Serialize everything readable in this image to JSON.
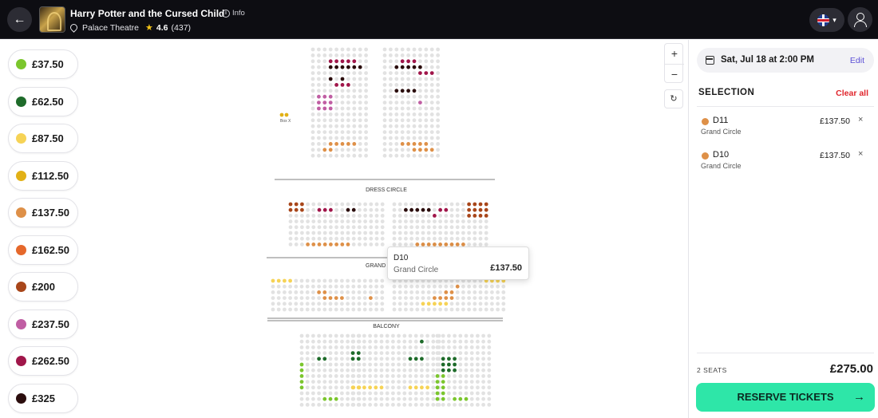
{
  "header": {
    "show_title": "Harry Potter and the Cursed Child",
    "info_label": "Info",
    "venue": "Palace Theatre",
    "rating": "4.6",
    "review_count": "(437)"
  },
  "legend": {
    "prices": [
      {
        "label": "£37.50",
        "color": "#7bc62d"
      },
      {
        "label": "£62.50",
        "color": "#1e6b2a"
      },
      {
        "label": "£87.50",
        "color": "#f6d356"
      },
      {
        "label": "£112.50",
        "color": "#e2b116"
      },
      {
        "label": "£137.50",
        "color": "#de9048"
      },
      {
        "label": "£162.50",
        "color": "#e5682b"
      },
      {
        "label": "£200",
        "color": "#a8461a"
      },
      {
        "label": "£237.50",
        "color": "#c05ea3"
      },
      {
        "label": "£262.50",
        "color": "#a0164a"
      },
      {
        "label": "£325",
        "color": "#2b0d0d"
      }
    ]
  },
  "map": {
    "section_labels": [
      "DRESS CIRCLE",
      "GRAND",
      "BALCONY"
    ],
    "box_label": "Box X",
    "zoom_in": "+",
    "zoom_out": "−",
    "reset": "↻"
  },
  "tooltip": {
    "seat": "D10",
    "area": "Grand Circle",
    "price": "£137.50"
  },
  "panel": {
    "date": "Sat, Jul 18 at 2:00 PM",
    "edit_label": "Edit",
    "selection_title": "SELECTION",
    "clear_all_label": "Clear all",
    "items": [
      {
        "seat": "D11",
        "area": "Grand Circle",
        "price": "£137.50",
        "color": "#de9048"
      },
      {
        "seat": "D10",
        "area": "Grand Circle",
        "price": "£137.50",
        "color": "#de9048"
      }
    ],
    "seat_count": "2 SEATS",
    "total": "£275.00",
    "reserve_label": "RESERVE TICKETS"
  }
}
